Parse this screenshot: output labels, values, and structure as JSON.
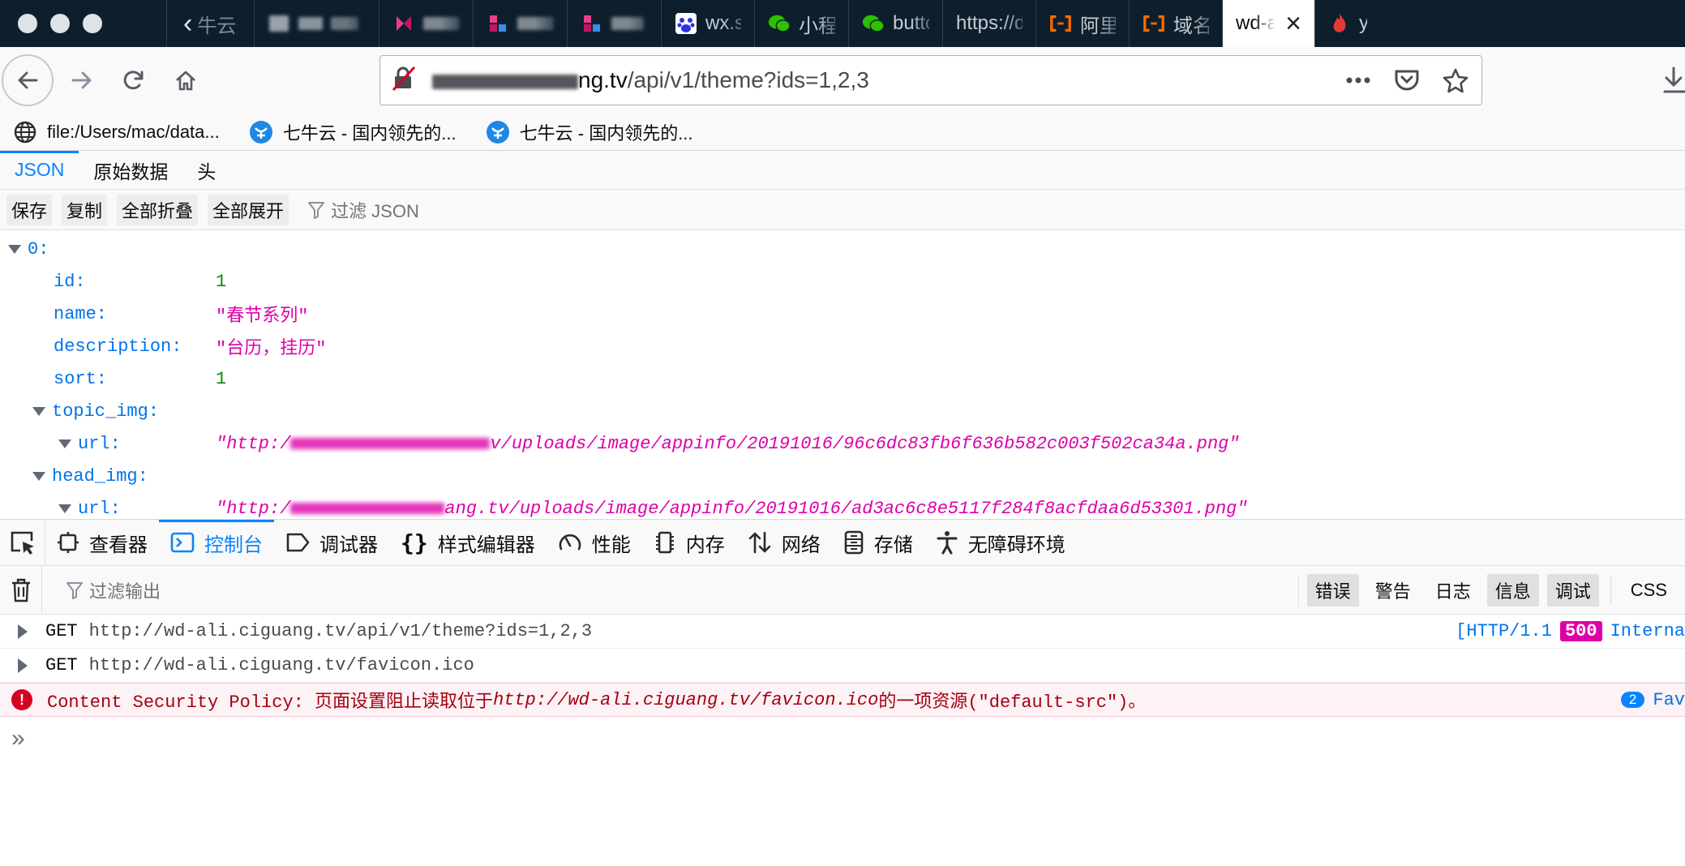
{
  "tabbar": {
    "scroll_fragment": "牛云",
    "tabs": [
      {
        "label": "",
        "favicon": "blurred"
      },
      {
        "label": "",
        "favicon": "yelp-pink"
      },
      {
        "label": "",
        "favicon": "pink-blue"
      },
      {
        "label": "",
        "favicon": "pink-blue"
      },
      {
        "label": "wx.set",
        "favicon": "baidu-icon"
      },
      {
        "label": "小程序",
        "favicon": "wechat-icon"
      },
      {
        "label": "button",
        "favicon": "wechat-icon"
      },
      {
        "label": "https://dev",
        "favicon": "none"
      },
      {
        "label": "阿里云",
        "favicon": "aliyun-icon"
      },
      {
        "label": "域名控",
        "favicon": "aliyun-icon"
      },
      {
        "label": "wd-ali.c",
        "favicon": "none",
        "active": true
      },
      {
        "label": "yyi",
        "favicon": "flame-icon"
      }
    ]
  },
  "navbar": {
    "url_host": "ng.tv",
    "url_path": "/api/v1/theme?ids=1,2,3"
  },
  "bookmarks": [
    {
      "label": "file:/Users/mac/data...",
      "icon": "globe-icon"
    },
    {
      "label": "七牛云 - 国内领先的...",
      "icon": "qiniu-icon"
    },
    {
      "label": "七牛云 - 国内领先的...",
      "icon": "qiniu-icon"
    }
  ],
  "json_viewer": {
    "tabs": [
      "JSON",
      "原始数据",
      "头"
    ],
    "toolbar": {
      "save": "保存",
      "copy": "复制",
      "collapse_all": "全部折叠",
      "expand_all": "全部展开",
      "filter_placeholder": "过滤 JSON"
    },
    "rows": {
      "root_key": "0:",
      "id_key": "id:",
      "id_val": "1",
      "name_key": "name:",
      "name_val": "\"春节系列\"",
      "desc_key": "description:",
      "desc_val": "\"台历，挂历\"",
      "sort_key": "sort:",
      "sort_val": "1",
      "topic_key": "topic_img:",
      "topic_url_key": "url:",
      "topic_url_prefix": "\"http:/",
      "topic_url_suffix": "v/uploads/image/appinfo/20191016/96c6dc83fb6f636b582c003f502ca34a.png\"",
      "head_key": "head_img:",
      "head_url_key": "url:",
      "head_url_prefix": "\"http:/",
      "head_url_suffix": "ang.tv/uploads/image/appinfo/20191016/ad3ac6c8e5117f284f8acfdaa6d53301.png\""
    }
  },
  "devtools": {
    "tabs": [
      {
        "label": "查看器",
        "icon": "inspector-icon"
      },
      {
        "label": "控制台",
        "icon": "console-icon",
        "active": true
      },
      {
        "label": "调试器",
        "icon": "debugger-icon"
      },
      {
        "label": "样式编辑器",
        "icon": "style-editor-icon"
      },
      {
        "label": "性能",
        "icon": "performance-icon"
      },
      {
        "label": "内存",
        "icon": "memory-icon"
      },
      {
        "label": "网络",
        "icon": "network-icon"
      },
      {
        "label": "存储",
        "icon": "storage-icon"
      },
      {
        "label": "无障碍环境",
        "icon": "accessibility-icon"
      }
    ],
    "filter_placeholder": "过滤输出",
    "levels": [
      {
        "label": "错误",
        "on": true
      },
      {
        "label": "警告",
        "on": false
      },
      {
        "label": "日志",
        "on": false
      },
      {
        "label": "信息",
        "on": true
      },
      {
        "label": "调试",
        "on": true
      },
      {
        "label": "CSS",
        "on": false
      }
    ]
  },
  "console": {
    "msg1": {
      "method": "GET",
      "url": "http://wd-ali.ciguang.tv/api/v1/theme?ids=1,2,3",
      "http": "[HTTP/1.1",
      "status": "500",
      "status_text": "Interna"
    },
    "msg2": {
      "method": "GET",
      "url": "http://wd-ali.ciguang.tv/favicon.ico"
    },
    "msg3": {
      "prefix": "Content Security Policy: 页面设置阻止读取位于 ",
      "url": "http://wd-ali.ciguang.tv/favicon.ico",
      "suffix": " 的一项资源(\"default-src\")。",
      "count": "2",
      "link": "Fav"
    },
    "prompt": "»"
  },
  "colors": {
    "accent": "#0a84ff",
    "tabbar_bg": "#0d1f2d",
    "string": "#dd00a9",
    "number": "#058b00",
    "key": "#0074e8",
    "error": "#d70022"
  }
}
